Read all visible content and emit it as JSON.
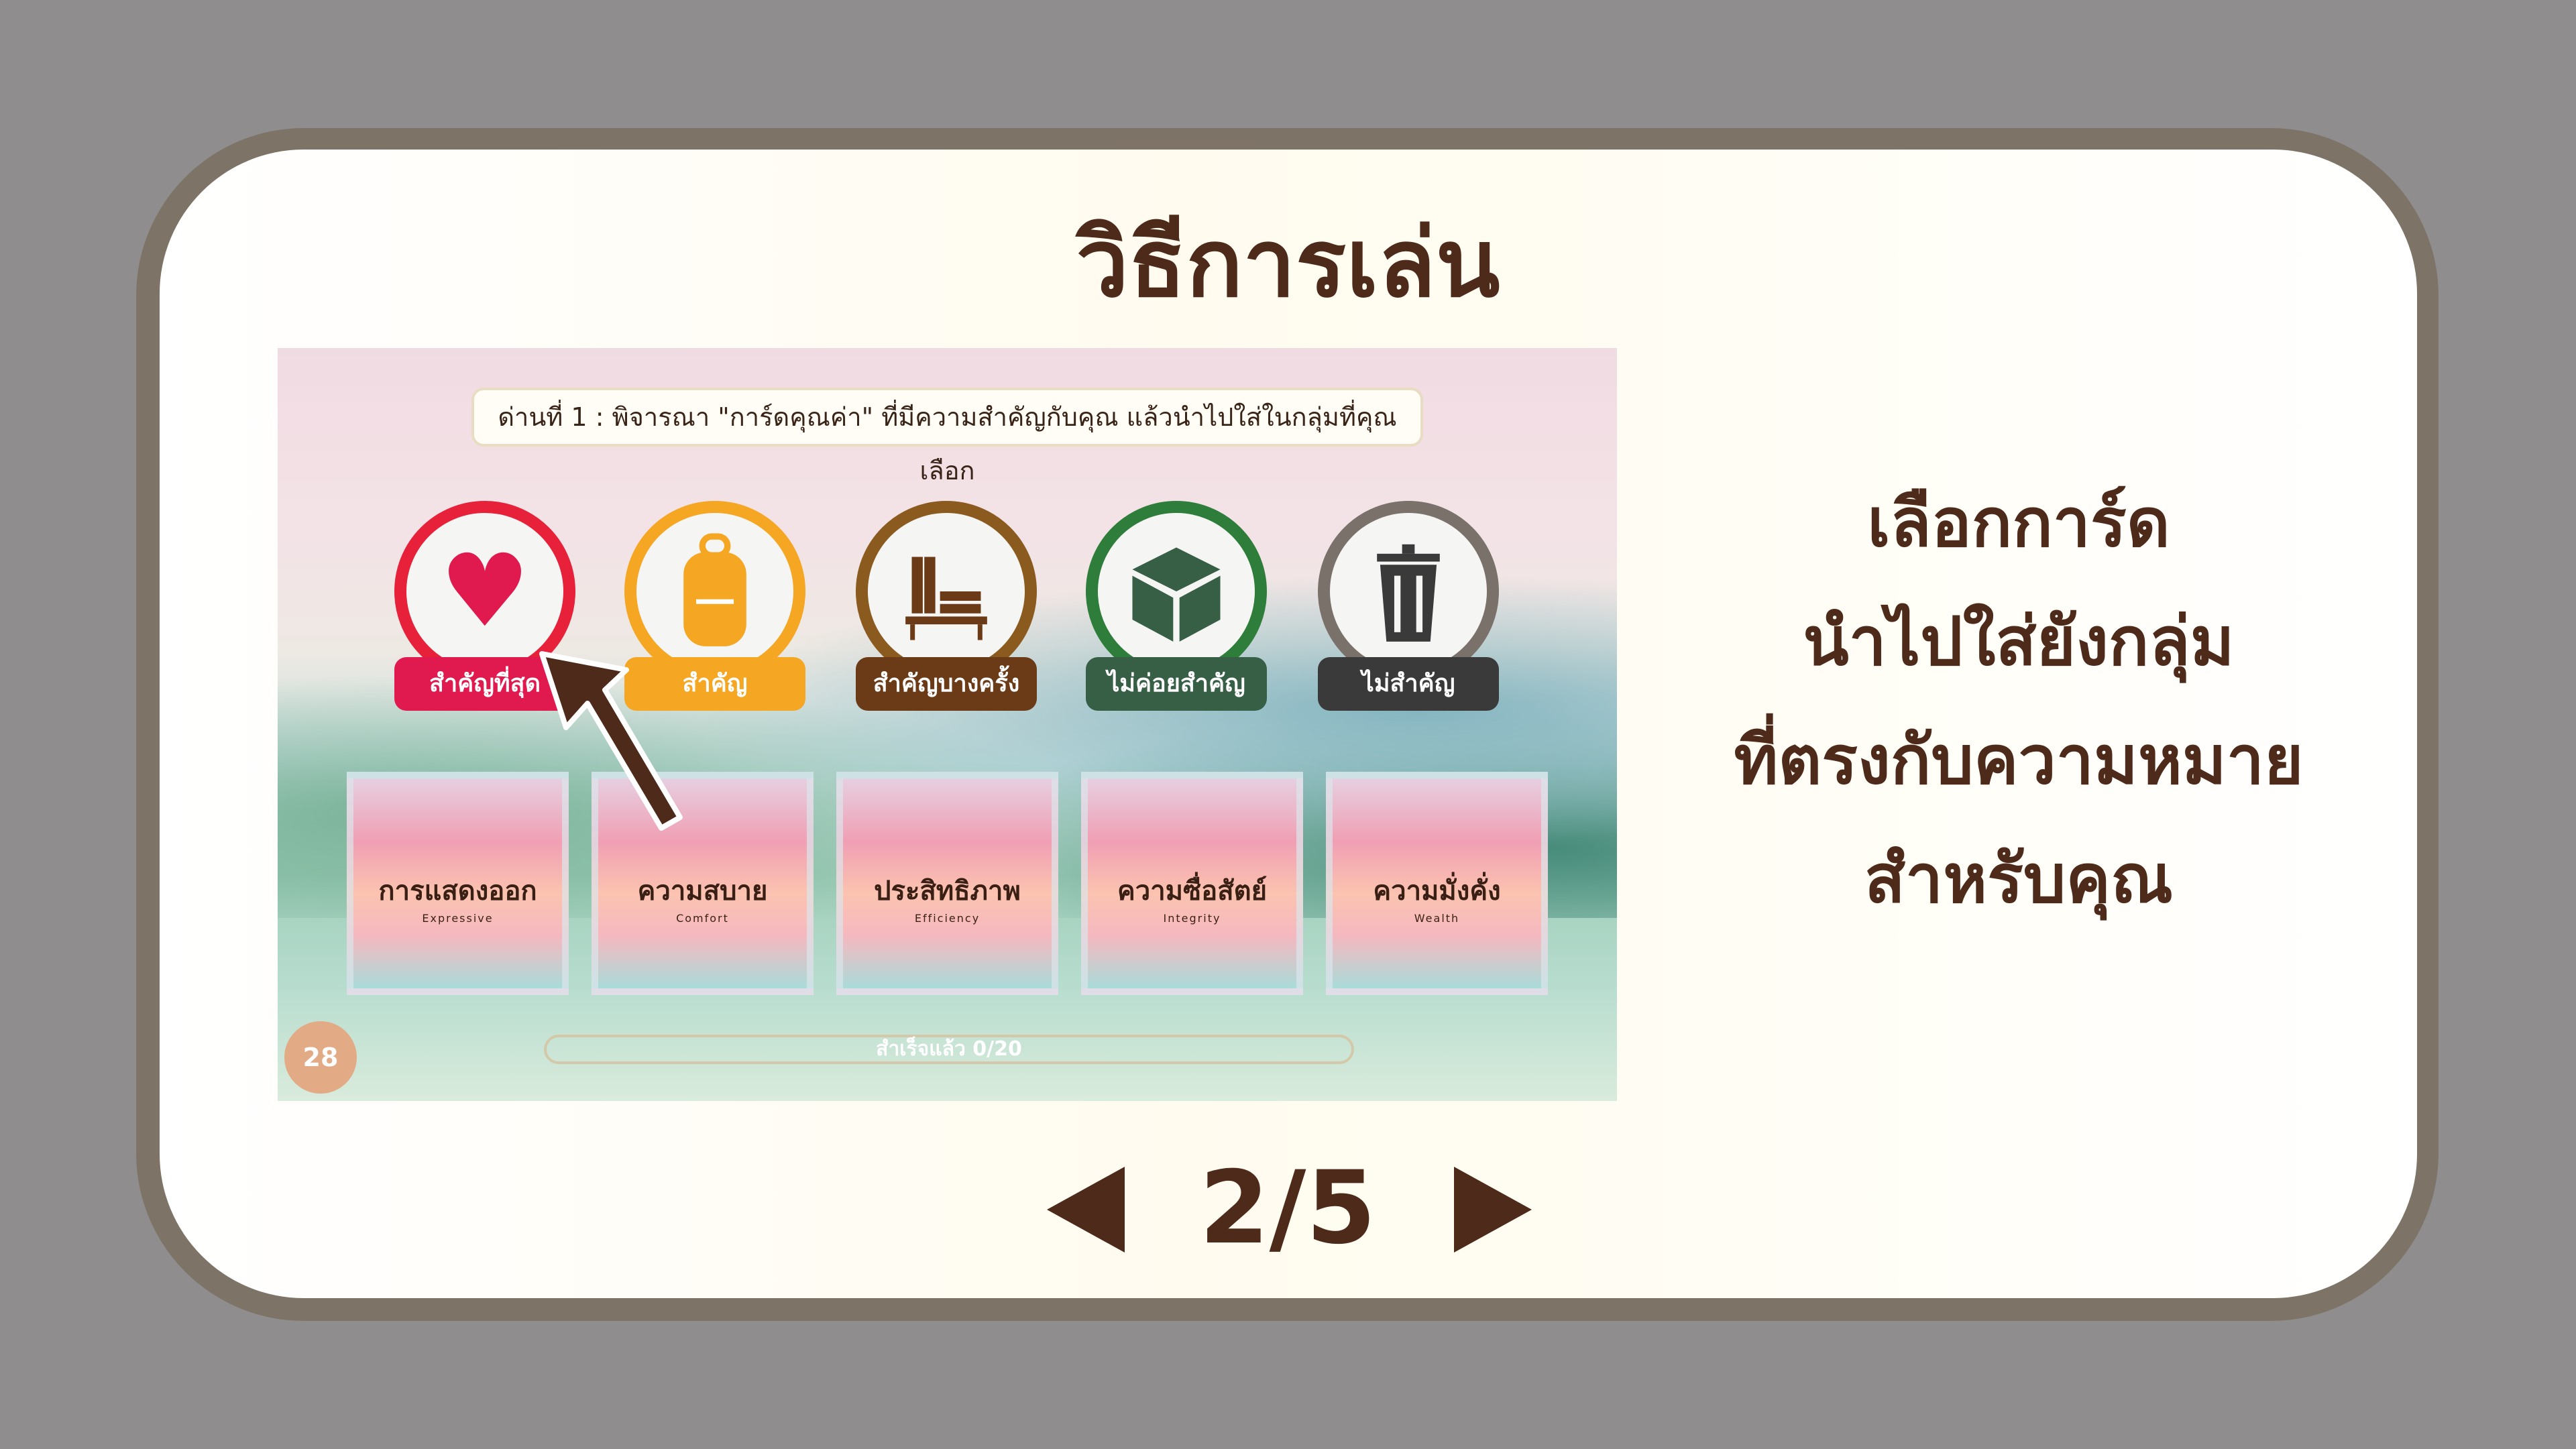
{
  "title": "วิธีการเล่น",
  "game": {
    "banner": "ด่านที่ 1 : พิจารณา \"การ์ดคุณค่า\" ที่มีความสำคัญกับคุณ แล้วนำไปใส่ในกลุ่มที่คุณเลือก",
    "categories": [
      {
        "label": "สำคัญที่สุด",
        "icon": "heart-icon",
        "color": "#e0194f"
      },
      {
        "label": "สำคัญ",
        "icon": "backpack-icon",
        "color": "#f5a623"
      },
      {
        "label": "สำคัญบางครั้ง",
        "icon": "bookshelf-icon",
        "color": "#6b3a17"
      },
      {
        "label": "ไม่ค่อยสำคัญ",
        "icon": "box-icon",
        "color": "#365f45"
      },
      {
        "label": "ไม่สำคัญ",
        "icon": "trash-icon",
        "color": "#3a3a3a"
      }
    ],
    "cards": [
      {
        "th": "การแสดงออก",
        "en": "Expressive"
      },
      {
        "th": "ความสบาย",
        "en": "Comfort"
      },
      {
        "th": "ประสิทธิภาพ",
        "en": "Efficiency"
      },
      {
        "th": "ความซื่อสัตย์",
        "en": "Integrity"
      },
      {
        "th": "ความมั่งคั่ง",
        "en": "Wealth"
      }
    ],
    "progress": "สำเร็จแล้ว 0/20",
    "timer": "28"
  },
  "instructions": [
    "เลือกการ์ด",
    "นำไปใส่ยังกลุ่ม",
    "ที่ตรงกับความหมาย",
    "สำหรับคุณ"
  ],
  "pagination": {
    "page": "2/5",
    "prev_icon": "triangle-left-icon",
    "next_icon": "triangle-right-icon"
  },
  "colors": {
    "text": "#4e2a1a",
    "frame": "#7d7467",
    "background": "#8f8d8e"
  }
}
